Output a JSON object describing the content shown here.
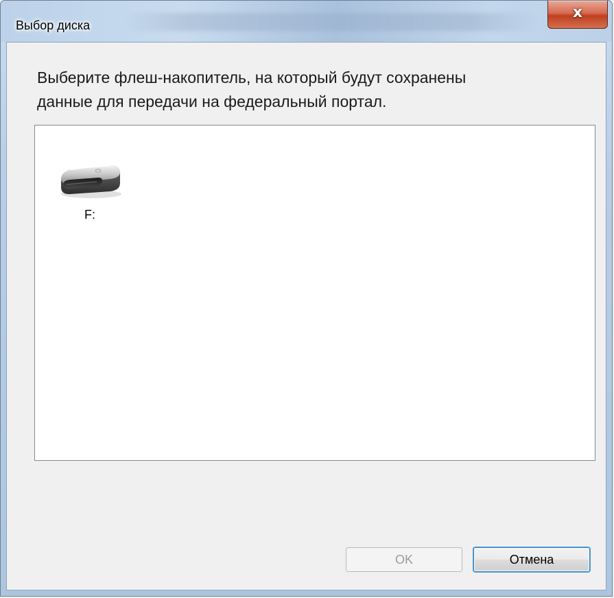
{
  "window": {
    "title": "Выбор диска",
    "close_glyph": "x"
  },
  "dialog": {
    "prompt_line1": "Выберите флеш-накопитель, на который будут сохранены",
    "prompt_line2": "данные для передачи на федеральный портал."
  },
  "drives": [
    {
      "label": "F:",
      "icon": "usb-flash-drive-icon"
    }
  ],
  "buttons": {
    "ok_label": "OK",
    "ok_enabled": false,
    "cancel_label": "Отмена"
  },
  "colors": {
    "close_button": "#c94a2e",
    "focus_border": "#3c7fb1"
  }
}
